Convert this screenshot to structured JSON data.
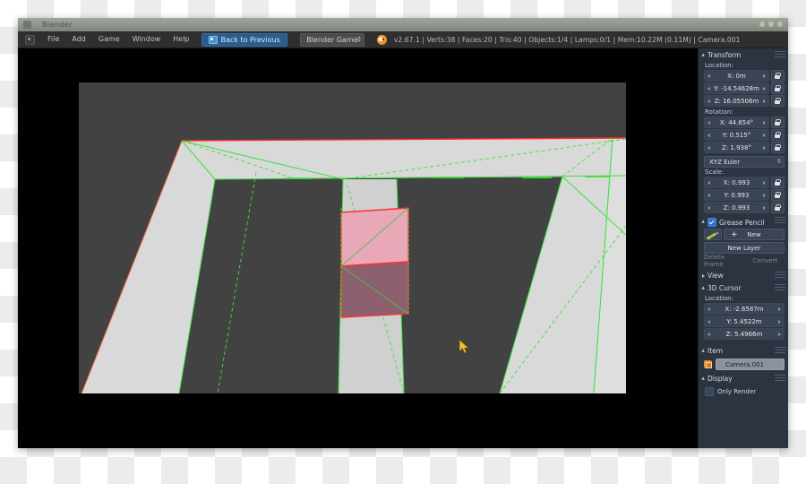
{
  "window": {
    "title": "Blender",
    "app_icon": "blender-app-icon",
    "controls": [
      "minimize-dot",
      "maximize-dot",
      "close-dot"
    ]
  },
  "header": {
    "editor_type_icon": "editor-type-icon",
    "menus": [
      "File",
      "Add",
      "Game",
      "Window",
      "Help"
    ],
    "back_button": {
      "label": "Back to Previous",
      "icon": "back-to-previous-icon"
    },
    "engine": {
      "value": "Blender Game",
      "icon": "chevron-updown-icon"
    },
    "logo_icon": "blender-logo-icon",
    "status": "v2.67.1 | Verts:38 | Faces:20 | Tris:40 | Objects:1/4 | Lamps:0/1 | Mem:10.22M (0.11M) | Camera.001"
  },
  "viewport": {
    "cursor_icon": "mouse-pointer-icon",
    "background": "#000000",
    "camera_background": "#424242",
    "colors": {
      "road": "#d9d9d9",
      "road_shadow": "#c9c9c9",
      "wire_green": "#3fe03f",
      "select_red": "#ff2d2d",
      "select_orange": "#e8622a",
      "cube_top": "#e8a8b8",
      "cube_front": "#8d6070",
      "cursor_yellow": "#f0c030"
    }
  },
  "properties": {
    "transform": {
      "title": "Transform",
      "location_label": "Location:",
      "location": [
        "X: 0m",
        "Y: -14.54628m",
        "Z: 16.05506m"
      ],
      "rotation_label": "Rotation:",
      "rotation": [
        "X: 44.654°",
        "Y: 0.515°",
        "Z: 1.938°"
      ],
      "rotation_mode": "XYZ Euler",
      "scale_label": "Scale:",
      "scale": [
        "X: 0.993",
        "Y: 0.993",
        "Z: 0.993"
      ],
      "lock_icon": "lock-icon"
    },
    "grease_pencil": {
      "title": "Grease Pencil",
      "enabled": true,
      "brush_icon": "pencil-icon",
      "new_label": "New",
      "plus_label": "+",
      "new_layer_label": "New Layer",
      "delete_frame_label": "Delete Frame",
      "convert_label": "Convert"
    },
    "view": {
      "title": "View"
    },
    "cursor3d": {
      "title": "3D Cursor",
      "location_label": "Location:",
      "location": [
        "X: -2.6587m",
        "Y: 5.4522m",
        "Z: 5.4966m"
      ]
    },
    "item": {
      "title": "Item",
      "object_icon": "object-data-icon",
      "name": "Camera.001"
    },
    "display": {
      "title": "Display",
      "only_render_label": "Only Render",
      "only_render_checked": false
    }
  }
}
